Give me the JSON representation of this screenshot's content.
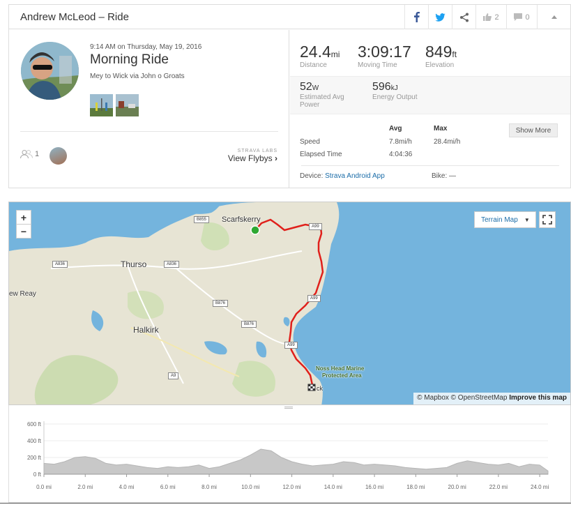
{
  "header": {
    "title": "Andrew McLeod – Ride",
    "kudos_count": "2",
    "comment_count": "0"
  },
  "activity": {
    "date": "9:14 AM on Thursday, May 19, 2016",
    "name": "Morning Ride",
    "description": "Mey to Wick via John o Groats",
    "athlete_count": "1",
    "labs_label": "STRAVA LABS",
    "flyby_label": "View Flybys"
  },
  "stats": {
    "distance": {
      "value": "24.4",
      "unit": "mi",
      "label": "Distance"
    },
    "moving_time": {
      "value": "3:09:17",
      "label": "Moving Time"
    },
    "elevation": {
      "value": "849",
      "unit": "ft",
      "label": "Elevation"
    },
    "power": {
      "value": "52",
      "unit": "W",
      "label": "Estimated Avg Power"
    },
    "energy": {
      "value": "596",
      "unit": "kJ",
      "label": "Energy Output"
    },
    "table": {
      "avg_header": "Avg",
      "max_header": "Max",
      "speed_label": "Speed",
      "speed_avg": "7.8mi/h",
      "speed_max": "28.4mi/h",
      "elapsed_label": "Elapsed Time",
      "elapsed_avg": "4:04:36"
    },
    "show_more": "Show More",
    "device_label": "Device:",
    "device_value": "Strava Android App",
    "bike_label": "Bike: —"
  },
  "map": {
    "zoom_in": "+",
    "zoom_out": "−",
    "map_type": "Terrain Map",
    "attribution_1": "© Mapbox © OpenStreetMap",
    "attribution_2": "Improve this map",
    "labels": {
      "scarfskerry": "Scarfskerry",
      "thurso": "Thurso",
      "halkirk": "Halkirk",
      "reay": "ew Reay",
      "noss": "Noss Head Marine",
      "noss2": "Protected Area",
      "wick": "ck"
    },
    "roads": {
      "b855": "B855",
      "a836a": "A836",
      "a836b": "A836",
      "b876a": "B876",
      "b876b": "B876",
      "a99a": "A99",
      "a99b": "A99",
      "a99c": "A99",
      "a9": "A9"
    },
    "colors": {
      "route": "#e0201b",
      "water": "#74b4dd",
      "land": "#e7e5d6",
      "start": "#2fa833"
    }
  },
  "elevation_chart": {
    "y_ticks": [
      "600 ft",
      "400 ft",
      "200 ft",
      "0 ft"
    ],
    "x_ticks": [
      "0.0 mi",
      "2.0 mi",
      "4.0 mi",
      "6.0 mi",
      "8.0 mi",
      "10.0 mi",
      "12.0 mi",
      "14.0 mi",
      "16.0 mi",
      "18.0 mi",
      "20.0 mi",
      "22.0 mi",
      "24.0 mi"
    ]
  },
  "chart_data": {
    "type": "area",
    "xlabel": "",
    "ylabel": "",
    "x_unit": "mi",
    "y_unit": "ft",
    "ylim": [
      0,
      600
    ],
    "xlim": [
      0,
      24.4
    ],
    "x": [
      0,
      0.5,
      1,
      1.5,
      2,
      2.5,
      3,
      3.5,
      4,
      4.5,
      5,
      5.5,
      6,
      6.5,
      7,
      7.5,
      8,
      8.5,
      9,
      9.5,
      10,
      10.5,
      11,
      11.5,
      12,
      12.5,
      13,
      13.5,
      14,
      14.5,
      15,
      15.5,
      16,
      16.5,
      17,
      17.5,
      18,
      18.5,
      19,
      19.5,
      20,
      20.5,
      21,
      21.5,
      22,
      22.5,
      23,
      23.5,
      24,
      24.4
    ],
    "y": [
      130,
      120,
      150,
      200,
      210,
      190,
      130,
      110,
      120,
      100,
      80,
      70,
      90,
      80,
      90,
      110,
      70,
      90,
      130,
      170,
      230,
      300,
      280,
      200,
      150,
      120,
      100,
      110,
      120,
      150,
      140,
      110,
      120,
      110,
      100,
      80,
      70,
      60,
      70,
      80,
      130,
      160,
      140,
      120,
      110,
      130,
      90,
      120,
      110,
      40
    ]
  }
}
